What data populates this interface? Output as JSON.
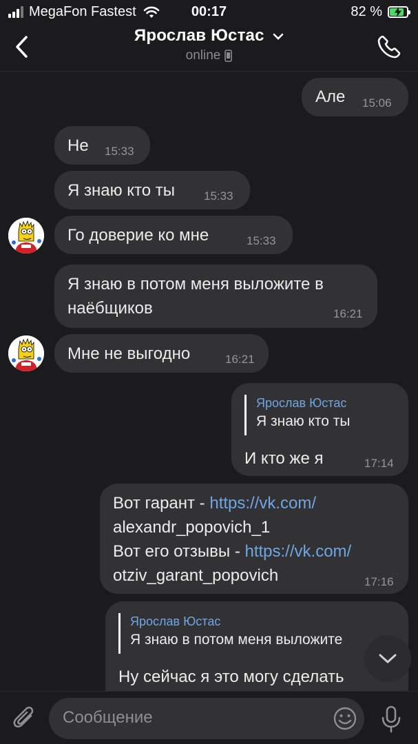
{
  "status_bar": {
    "carrier": "MegaFon Fastest",
    "time": "00:17",
    "battery_percent": "82 %",
    "battery_level": 0.82
  },
  "header": {
    "back_icon": "chevron-left-icon",
    "contact_name": "Ярослав Юстас",
    "status": "online",
    "call_icon": "phone-icon"
  },
  "messages": [
    {
      "direction": "out",
      "text": "Але",
      "time": "15:06"
    },
    {
      "direction": "in",
      "text": "Не",
      "time": "15:33"
    },
    {
      "direction": "in",
      "text": "Я знаю кто ты",
      "time": "15:33"
    },
    {
      "direction": "in",
      "text": "Го доверие ко мне",
      "time": "15:33"
    },
    {
      "direction": "in",
      "text_line1": "Я знаю в потом меня выложите в",
      "text_line2": "наёбщиков",
      "time": "16:21"
    },
    {
      "direction": "in",
      "text": "Мне не выгодно",
      "time": "16:21"
    },
    {
      "direction": "out",
      "reply_author": "Ярослав Юстас",
      "reply_text": "Я знаю кто ты",
      "text": "И кто же я",
      "time": "17:14"
    },
    {
      "direction": "out",
      "line1_prefix": "Вот гарант - ",
      "line1_link": "https://vk.com/",
      "line2_link": "alexandr_popovich_1",
      "line3_prefix": "Вот его отзывы - ",
      "line3_link": "https://vk.com/",
      "line4_link": "otziv_garant_popovich",
      "time": "17:16"
    },
    {
      "direction": "out",
      "reply_author": "Ярослав Юстас",
      "reply_text": "Я знаю в потом меня выложите",
      "text": "Ну сейчас я это могу сделать"
    }
  ],
  "composer": {
    "placeholder": "Сообщение",
    "attach_icon": "paperclip-icon",
    "emoji_icon": "emoji-icon",
    "mic_icon": "microphone-icon"
  },
  "scroll_down_icon": "chevron-down-icon",
  "colors": {
    "background": "#1b1b1d",
    "bubble": "#323235",
    "link": "#6ea6e3",
    "battery": "#4cd964"
  }
}
